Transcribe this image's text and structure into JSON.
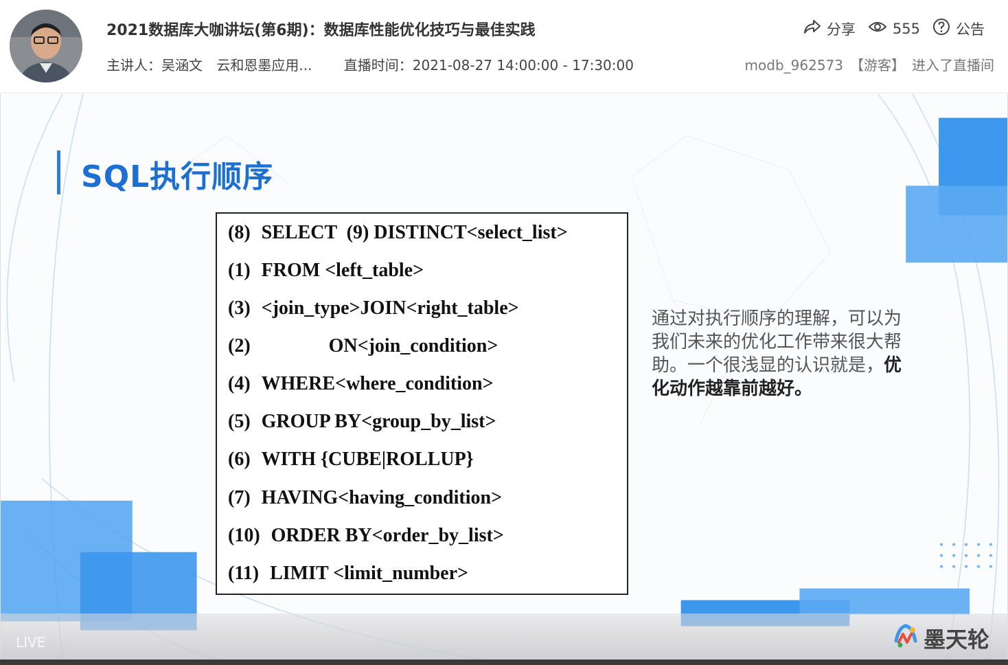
{
  "header": {
    "title": "2021数据库大咖讲坛(第6期)：数据库性能优化技巧与最佳实践",
    "speaker_label": "主讲人：吴涵文",
    "company": "云和恩墨应用...",
    "time_label": "直播时间：2021-08-27 14:00:00 - 17:30:00",
    "share_label": "分享",
    "views": "555",
    "notice_label": "公告",
    "user": "modb_962573",
    "role": "【游客】",
    "joined_text": "进入了直播间"
  },
  "slide": {
    "heading": "SQL执行顺序",
    "sql_lines": [
      {
        "num": "(8)",
        "text": "SELECT  (9) DISTINCT<select_list>"
      },
      {
        "num": "(1)",
        "text": "FROM <left_table>"
      },
      {
        "num": "(3)",
        "text": "<join_type>JOIN<right_table>"
      },
      {
        "num": "(2)",
        "text": "              ON<join_condition>"
      },
      {
        "num": "(4)",
        "text": "WHERE<where_condition>"
      },
      {
        "num": "(5)",
        "text": "GROUP BY<group_by_list>"
      },
      {
        "num": "(6)",
        "text": "WITH {CUBE|ROLLUP}"
      },
      {
        "num": "(7)",
        "text": "HAVING<having_condition>"
      },
      {
        "num": "(10)",
        "text": "ORDER BY<order_by_list>"
      },
      {
        "num": "(11)",
        "text": "LIMIT <limit_number>"
      }
    ],
    "desc_normal": "通过对执行顺序的理解，可以为我们未来的优化工作带来很大帮助。一个很浅显的认识就是，",
    "desc_bold": "优化动作越靠前越好。",
    "live_label": "LIVE",
    "logo_text": "墨天轮"
  },
  "colors": {
    "accent": "#1d6fd1",
    "block_blue": "#3d97ec"
  },
  "icons": [
    "share-icon",
    "eye-icon",
    "question-circle-icon",
    "modb-logo-icon"
  ]
}
